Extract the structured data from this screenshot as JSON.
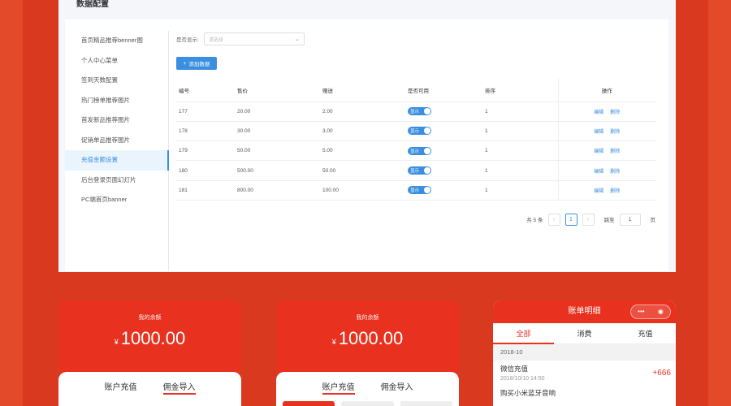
{
  "panel": {
    "title": "数据配置"
  },
  "menu": [
    "首页精品推荐benner图",
    "个人中心菜单",
    "签到天数配置",
    "热门榜单推荐图片",
    "首发新品推荐图片",
    "促销单品推荐图片",
    "充值金额设置",
    "后台登录页面幻灯片",
    "PC端首页banner"
  ],
  "active_menu_index": 6,
  "filter": {
    "label": "是否显示:",
    "placeholder": "请选择"
  },
  "add_button": "添加数据",
  "table": {
    "headers": [
      "编号",
      "售价",
      "赠送",
      "是否可用",
      "排序",
      "操作"
    ],
    "rows": [
      [
        "177",
        "20.00",
        "2.00",
        "显示",
        "1"
      ],
      [
        "178",
        "30.00",
        "3.00",
        "显示",
        "1"
      ],
      [
        "179",
        "50.00",
        "5.00",
        "显示",
        "1"
      ],
      [
        "180",
        "500.00",
        "50.00",
        "显示",
        "1"
      ],
      [
        "181",
        "800.00",
        "100.00",
        "显示",
        "1"
      ]
    ],
    "edit_label": "编辑",
    "delete_label": "删除"
  },
  "pagination": {
    "total": "共 5 条",
    "prev": "‹",
    "current": "1",
    "next": "›",
    "jump_label": "跳至",
    "jump_value": "1",
    "page_unit": "页"
  },
  "card1": {
    "label": "我的余额",
    "currency": "¥",
    "amount": "1000.00",
    "tabs": [
      "账户充值",
      "佣金导入"
    ],
    "active_tab": 1
  },
  "card2": {
    "label": "我的余额",
    "currency": "¥",
    "amount": "1000.00",
    "tabs": [
      "账户充值",
      "佣金导入"
    ],
    "active_tab": 0
  },
  "card3": {
    "title": "账单明细",
    "capsule": {
      "more": "•••",
      "close": "◉"
    },
    "tabs": [
      "全部",
      "消费",
      "充值"
    ],
    "month": "2018-10",
    "entries": [
      {
        "title": "微信充值",
        "date": "2018/10/10 14:50",
        "amount": "+666"
      },
      {
        "title": "购买小米蓝牙音响",
        "date": "",
        "amount": ""
      }
    ]
  },
  "colors": {
    "accent": "#e8321f",
    "background": "#d93a1f",
    "link": "#3b8fe0"
  }
}
